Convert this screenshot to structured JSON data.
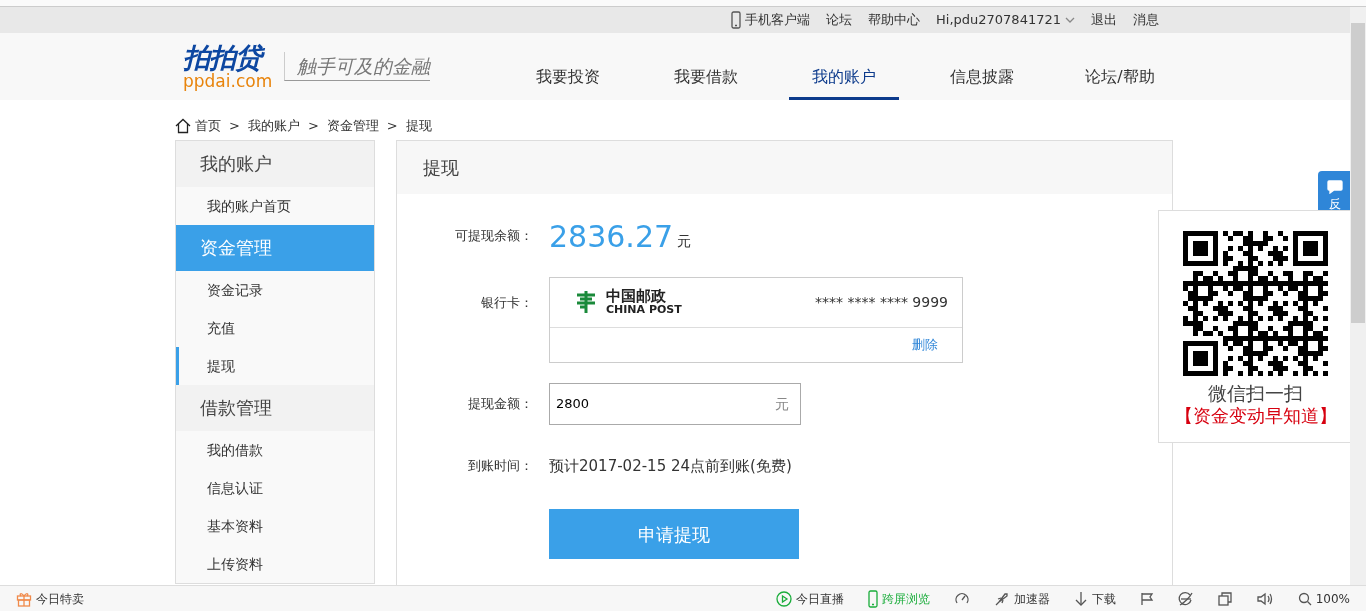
{
  "topbar": {
    "links": [
      {
        "kind": "phone",
        "label": "手机客户端"
      },
      {
        "kind": "plain",
        "label": "论坛"
      },
      {
        "kind": "plain",
        "label": "帮助中心"
      },
      {
        "kind": "user",
        "label": "Hi,pdu2707841721"
      },
      {
        "kind": "plain",
        "label": "退出"
      },
      {
        "kind": "plain",
        "label": "消息"
      }
    ]
  },
  "header": {
    "logo": {
      "name": "拍拍贷",
      "domain": "ppdai.com"
    },
    "slogan": "触手可及的金融",
    "nav": [
      {
        "label": "我要投资",
        "selected": false
      },
      {
        "label": "我要借款",
        "selected": false
      },
      {
        "label": "我的账户",
        "selected": true
      },
      {
        "label": "信息披露",
        "selected": false
      },
      {
        "label": "论坛/帮助",
        "selected": false
      }
    ]
  },
  "breadcrumb": [
    {
      "kind": "link",
      "label": "首页"
    },
    {
      "kind": "separator",
      "label": ">"
    },
    {
      "kind": "link",
      "label": "我的账户"
    },
    {
      "kind": "separator",
      "label": ">"
    },
    {
      "kind": "link",
      "label": "资金管理"
    },
    {
      "kind": "separator",
      "label": ">"
    },
    {
      "kind": "current",
      "label": "提现"
    }
  ],
  "sidebar": {
    "sections": [
      {
        "title": "我的账户",
        "selected": false,
        "items": [
          {
            "label": "我的账户首页",
            "selected": false
          }
        ]
      },
      {
        "title": "资金管理",
        "selected": true,
        "items": [
          {
            "label": "资金记录",
            "selected": false
          },
          {
            "label": "充值",
            "selected": false
          },
          {
            "label": "提现",
            "selected": true
          }
        ]
      },
      {
        "title": "借款管理",
        "selected": false,
        "items": [
          {
            "label": "我的借款",
            "selected": false
          },
          {
            "label": "信息认证",
            "selected": false
          },
          {
            "label": "基本资料",
            "selected": false
          },
          {
            "label": "上传资料",
            "selected": false
          }
        ]
      }
    ]
  },
  "panel": {
    "title": "提现",
    "balance": {
      "label": "可提现余额：",
      "amount": "2836.27",
      "unit": "元"
    },
    "bank_card": {
      "label": "银行卡：",
      "bank_cn": "中国邮政",
      "bank_en": "CHINA POST",
      "number": "**** **** **** 9999",
      "delete": "删除"
    },
    "withdraw_amount": {
      "label": "提现金额：",
      "value": "2800",
      "unit": "元"
    },
    "arrival": {
      "label": "到账时间：",
      "text": "预计2017-02-15 24点前到账(免费)"
    },
    "submit": "申请提现"
  },
  "feedback_tab": {
    "label": "反"
  },
  "qr_popup": {
    "caption": "微信扫一扫",
    "slogan": "【资金变动早知道】"
  },
  "status_bar": {
    "left": [
      {
        "kind": "gift",
        "label": "今日特卖",
        "highlight": false
      }
    ],
    "right": [
      {
        "kind": "play",
        "label": "今日直播",
        "highlight": false
      },
      {
        "kind": "phone",
        "label": "跨屏浏览",
        "highlight": true
      },
      {
        "kind": "speed",
        "highlight": false
      },
      {
        "kind": "rocket",
        "label": "加速器",
        "highlight": false
      },
      {
        "kind": "download",
        "label": "下载",
        "highlight": false
      },
      {
        "kind": "flag",
        "highlight": false
      },
      {
        "kind": "ie",
        "highlight": false
      },
      {
        "kind": "window",
        "highlight": false
      },
      {
        "kind": "sound",
        "highlight": false
      },
      {
        "kind": "zoom",
        "label": "100%",
        "highlight": false
      }
    ]
  }
}
